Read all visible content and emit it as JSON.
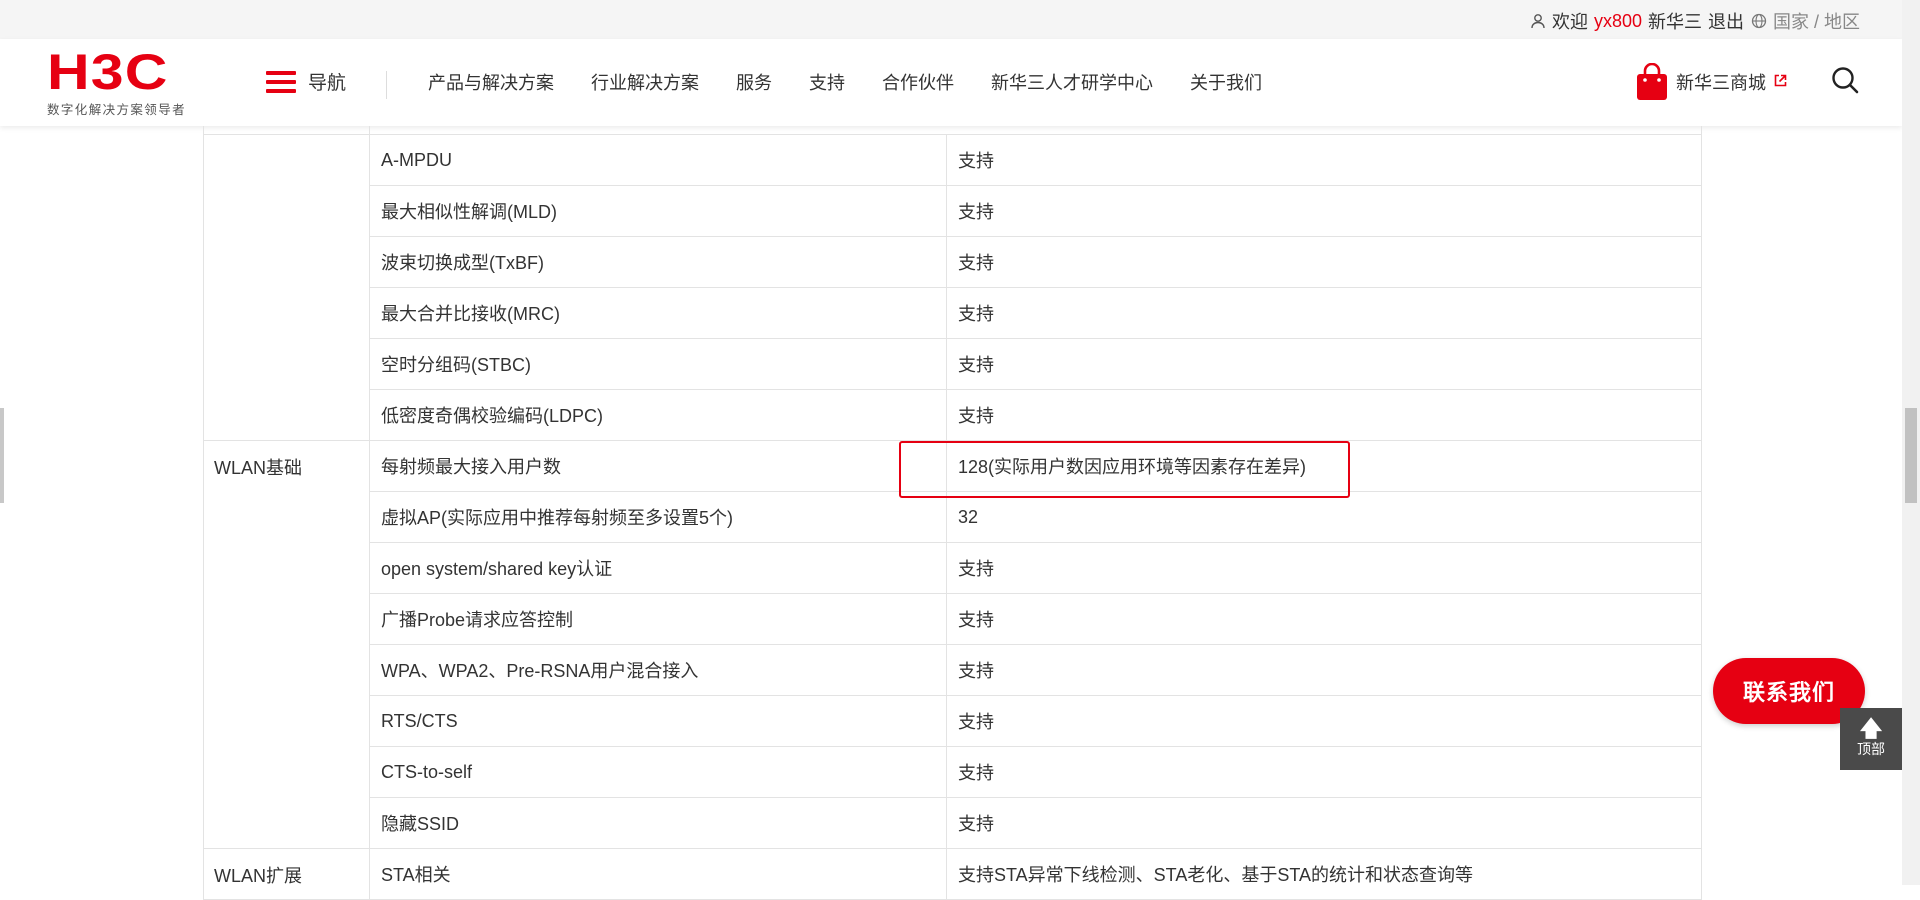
{
  "topbar": {
    "welcome": "欢迎",
    "username": "yx800",
    "company": "新华三",
    "logout": "退出",
    "region": "国家 / 地区"
  },
  "header": {
    "logo_text": "H3C",
    "slogan": "数字化解决方案领导者",
    "nav_label": "导航",
    "nav_items": [
      "产品与解决方案",
      "行业解决方案",
      "服务",
      "支持",
      "合作伙伴",
      "新华三人才研学中心",
      "关于我们"
    ],
    "mall_label": "新华三商城"
  },
  "spec_table": {
    "rows": [
      {
        "category": "",
        "feature": "A-MPDU",
        "value": "支持"
      },
      {
        "category": "",
        "feature": "最大相似性解调(MLD)",
        "value": "支持"
      },
      {
        "category": "",
        "feature": "波束切换成型(TxBF)",
        "value": "支持"
      },
      {
        "category": "",
        "feature": "最大合并比接收(MRC)",
        "value": "支持"
      },
      {
        "category": "",
        "feature": "空时分组码(STBC)",
        "value": "支持"
      },
      {
        "category": "",
        "feature": "低密度奇偶校验编码(LDPC)",
        "value": "支持"
      },
      {
        "category": "WLAN基础",
        "feature": "每射频最大接入用户数",
        "value": "128(实际用户数因应用环境等因素存在差异)"
      },
      {
        "category": "",
        "feature": "虚拟AP(实际应用中推荐每射频至多设置5个)",
        "value": "32"
      },
      {
        "category": "",
        "feature": "open system/shared key认证",
        "value": "支持"
      },
      {
        "category": "",
        "feature": "广播Probe请求应答控制",
        "value": "支持"
      },
      {
        "category": "",
        "feature": "WPA、WPA2、Pre-RSNA用户混合接入",
        "value": "支持"
      },
      {
        "category": "",
        "feature": "RTS/CTS",
        "value": "支持"
      },
      {
        "category": "",
        "feature": "CTS-to-self",
        "value": "支持"
      },
      {
        "category": "",
        "feature": "隐藏SSID",
        "value": "支持"
      },
      {
        "category": "WLAN扩展",
        "feature": "STA相关",
        "value": "支持STA异常下线检测、STA老化、基于STA的统计和状态查询等"
      }
    ]
  },
  "floating": {
    "contact": "联系我们",
    "top": "顶部"
  },
  "colors": {
    "brand_red": "#e60012"
  }
}
